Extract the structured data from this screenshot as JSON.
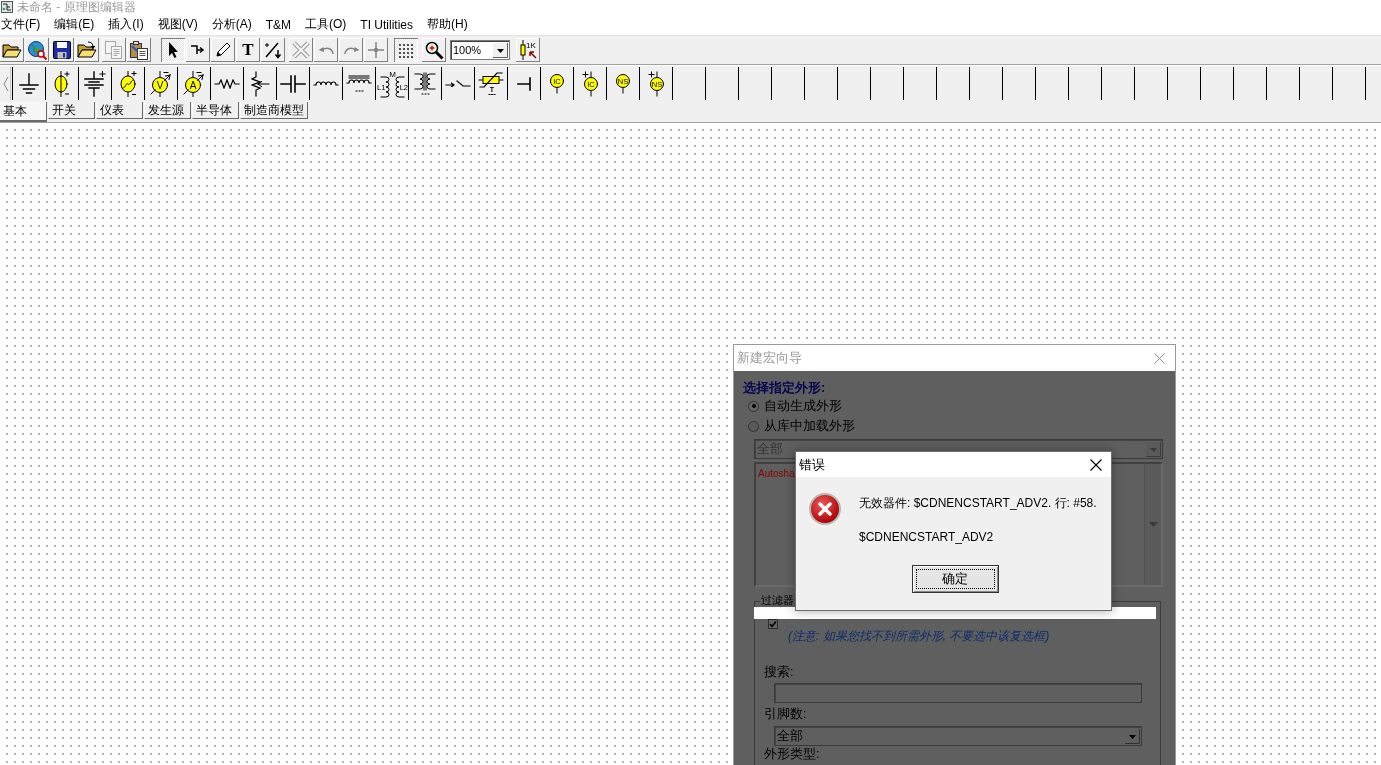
{
  "window": {
    "title": "未命名 - 原理图编辑器"
  },
  "menu": [
    "文件(F)",
    "编辑(E)",
    "插入(I)",
    "视图(V)",
    "分析(A)",
    "T&M",
    "工具(O)",
    "TI Utilities",
    "帮助(H)"
  ],
  "toolbar": {
    "groups": [
      [
        {
          "kind": "open",
          "disabled": false,
          "pressed": false
        },
        {
          "kind": "web",
          "disabled": false,
          "pressed": false
        },
        {
          "kind": "save",
          "disabled": false,
          "pressed": false
        },
        {
          "kind": "import",
          "disabled": false,
          "pressed": false
        }
      ],
      [
        {
          "kind": "copy",
          "disabled": true,
          "pressed": false
        },
        {
          "kind": "paste",
          "disabled": false,
          "pressed": false
        }
      ],
      [
        {
          "kind": "pointer",
          "disabled": false,
          "pressed": true
        },
        {
          "kind": "wire",
          "disabled": false,
          "pressed": false
        },
        {
          "kind": "pencil",
          "disabled": false,
          "pressed": false
        },
        {
          "kind": "text",
          "label": "T",
          "disabled": false,
          "pressed": false
        },
        {
          "kind": "probe",
          "disabled": false,
          "pressed": false
        }
      ],
      [
        {
          "kind": "delete",
          "disabled": true,
          "pressed": false
        },
        {
          "kind": "undo",
          "disabled": true,
          "pressed": false
        },
        {
          "kind": "redo",
          "disabled": true,
          "pressed": false
        },
        {
          "kind": "junction",
          "disabled": true,
          "pressed": false
        }
      ],
      [
        {
          "kind": "grid",
          "disabled": false,
          "pressed": true
        }
      ],
      [
        {
          "kind": "zoom",
          "disabled": false,
          "pressed": false
        },
        {
          "kind": "select",
          "value": "100%",
          "disabled": false
        }
      ],
      [
        {
          "kind": "part",
          "label": "1K",
          "disabled": false,
          "pressed": false
        }
      ]
    ]
  },
  "palette": {
    "items": [
      {
        "kind": "ground"
      },
      {
        "kind": "dc-source"
      },
      {
        "kind": "battery"
      },
      {
        "kind": "ac-source"
      },
      {
        "kind": "meter",
        "label": "V"
      },
      {
        "kind": "meter",
        "label": "A"
      },
      {
        "kind": "resistor"
      },
      {
        "kind": "potentiometer"
      },
      {
        "kind": "capacitor"
      },
      {
        "kind": "inductor"
      },
      {
        "kind": "core-inductor"
      },
      {
        "kind": "transformer",
        "labels": [
          "M",
          "L1",
          "L2"
        ]
      },
      {
        "kind": "core-transformer"
      },
      {
        "kind": "switch"
      },
      {
        "kind": "thermistor",
        "label": "T"
      },
      {
        "kind": "terminal"
      },
      {
        "kind": "circle-source",
        "label": "IC"
      },
      {
        "kind": "circle-source-plus",
        "label": "IC"
      },
      {
        "kind": "circle-source",
        "label": "NS"
      },
      {
        "kind": "circle-source-plus",
        "label": "NS"
      }
    ]
  },
  "palette_tabs": [
    {
      "label": "基本",
      "selected": true
    },
    {
      "label": "开关",
      "selected": false
    },
    {
      "label": "仪表",
      "selected": false
    },
    {
      "label": "发生源",
      "selected": false
    },
    {
      "label": "半导体",
      "selected": false
    },
    {
      "label": "制造商模型",
      "selected": false
    }
  ],
  "wizard_dialog": {
    "title": "新建宏向导",
    "heading": "选择指定外形:",
    "shape_options": [
      {
        "label": "自动生成外形",
        "selected": true
      },
      {
        "label": "从库中加载外形",
        "selected": false
      }
    ],
    "library_select": {
      "value": "全部",
      "disabled": true
    },
    "shape_list": {
      "items": [
        "Autosha"
      ]
    },
    "filter": {
      "title": "过滤器",
      "recommended_only": {
        "checked": true
      },
      "note": "(注意: 如果您找不到所需外形, 不要选中该复选框)",
      "search": {
        "label": "搜索:"
      },
      "pin_count": {
        "label": "引脚数:",
        "value": "全部"
      },
      "shape_type": {
        "label": "外形类型:"
      }
    }
  },
  "error_dialog": {
    "title": "错误",
    "message": "无效器件: $CDNENCSTART_ADV2. 行: #58.",
    "detail": "$CDNENCSTART_ADV2",
    "button": "确定"
  }
}
